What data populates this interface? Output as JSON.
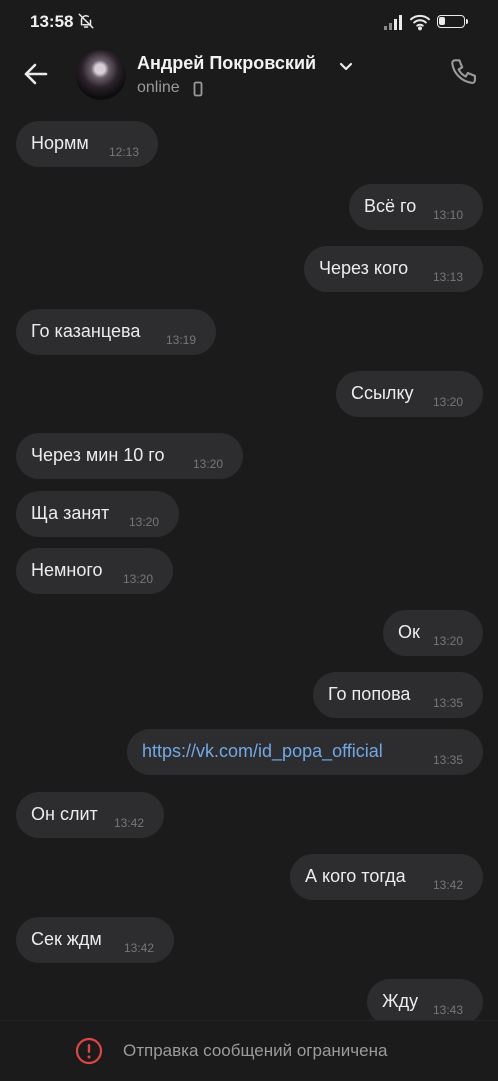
{
  "status_bar": {
    "time": "13:58",
    "battery": "24",
    "battery_level": 0.24
  },
  "header": {
    "contact_name": "Андрей Покровский",
    "status": "online"
  },
  "messages": [
    {
      "side": "in",
      "text": "Нормм",
      "time": "12:13"
    },
    {
      "side": "out",
      "text": "Всё го",
      "time": "13:10"
    },
    {
      "side": "out",
      "text": "Через кого",
      "time": "13:13"
    },
    {
      "side": "in",
      "text": "Го казанцева",
      "time": "13:19"
    },
    {
      "side": "out",
      "text": "Ссылку",
      "time": "13:20"
    },
    {
      "side": "in",
      "text": "Через мин 10 го",
      "time": "13:20"
    },
    {
      "side": "in",
      "text": "Ща занят",
      "time": "13:20"
    },
    {
      "side": "in",
      "text": "Немного",
      "time": "13:20"
    },
    {
      "side": "out",
      "text": "Ок",
      "time": "13:20"
    },
    {
      "side": "out",
      "text": "Го попова",
      "time": "13:35"
    },
    {
      "side": "out",
      "text": "https://vk.com/id_popa_official",
      "time": "13:35",
      "link": true
    },
    {
      "side": "in",
      "text": "Он слит",
      "time": "13:42"
    },
    {
      "side": "out",
      "text": "А кого тогда",
      "time": "13:42"
    },
    {
      "side": "in",
      "text": "Сек ждм",
      "time": "13:42"
    },
    {
      "side": "out",
      "text": "Жду",
      "time": "13:43"
    }
  ],
  "footer": {
    "notice": "Отправка сообщений ограничена"
  },
  "colors": {
    "background": "#1b1b1c",
    "bubble": "#2d2d2f",
    "link": "#72a8e6",
    "warning": "#e04545"
  }
}
